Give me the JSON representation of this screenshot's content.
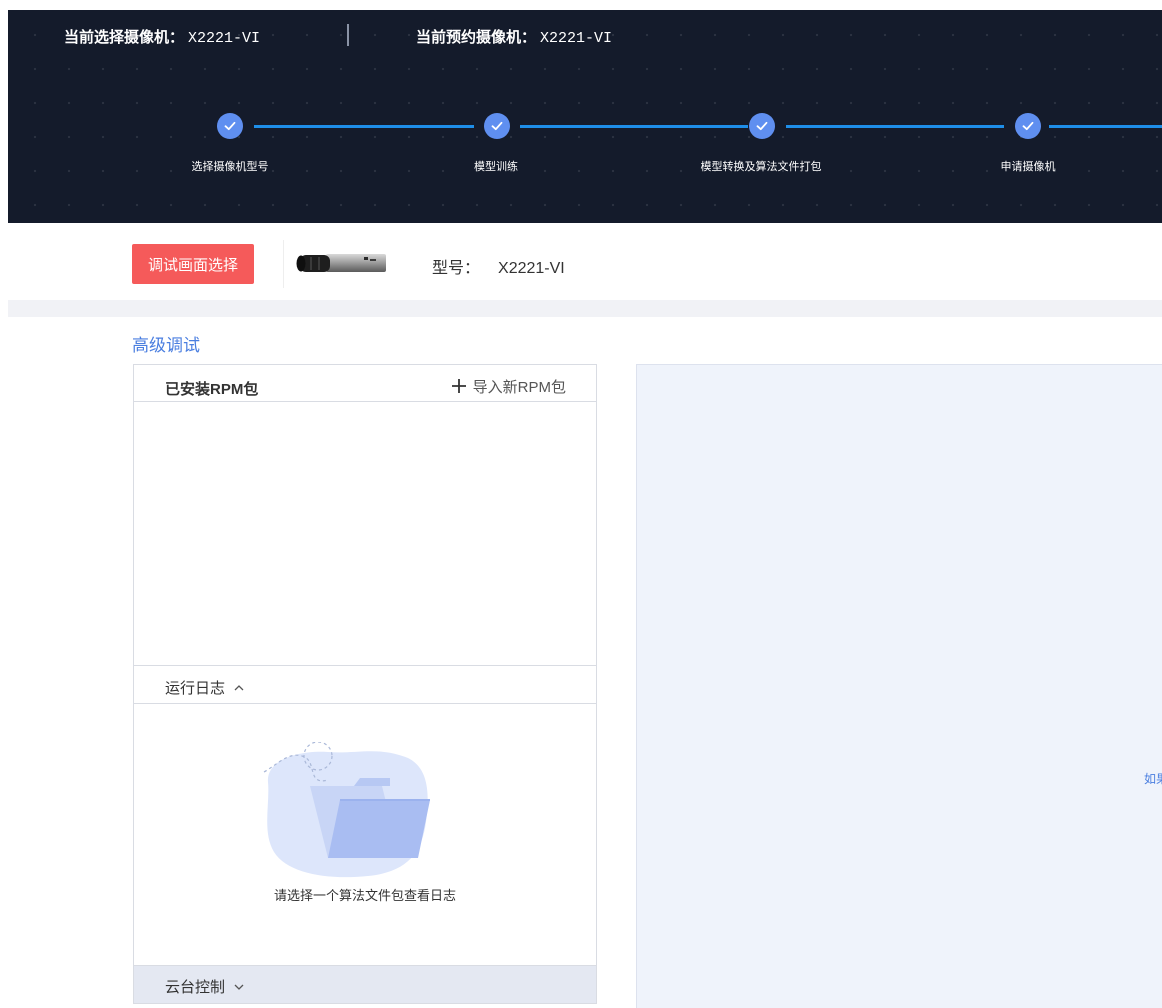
{
  "header": {
    "current_camera_label": "当前选择摄像机：",
    "current_camera_value": "X2221-VI",
    "reserved_camera_label": "当前预约摄像机：",
    "reserved_camera_value": "X2221-VI",
    "steps": [
      {
        "label": "选择摄像机型号",
        "status": "completed"
      },
      {
        "label": "模型训练",
        "status": "completed"
      },
      {
        "label": "模型转换及算法文件打包",
        "status": "completed"
      },
      {
        "label": "申请摄像机",
        "status": "completed"
      }
    ]
  },
  "toolbar": {
    "debug_button_label": "调试画面选择",
    "model_label": "型号：",
    "model_value": "X2221-VI"
  },
  "section": {
    "title": "高级调试"
  },
  "rpm_panel": {
    "title": "已安装RPM包",
    "import_label": "导入新RPM包",
    "items": []
  },
  "log_panel": {
    "title": "运行日志",
    "expanded": true,
    "empty_text": "请选择一个算法文件包查看日志"
  },
  "ptz_panel": {
    "title": "云台控制",
    "expanded": false
  },
  "right_panel": {
    "hint_text": "如果"
  },
  "colors": {
    "header_bg": "#141b2b",
    "step_line": "#1e8ee8",
    "step_circle": "#5f8ff0",
    "debug_button": "#f55a5a",
    "accent_text": "#4a7ee0",
    "right_panel_bg": "#eff3fb"
  }
}
